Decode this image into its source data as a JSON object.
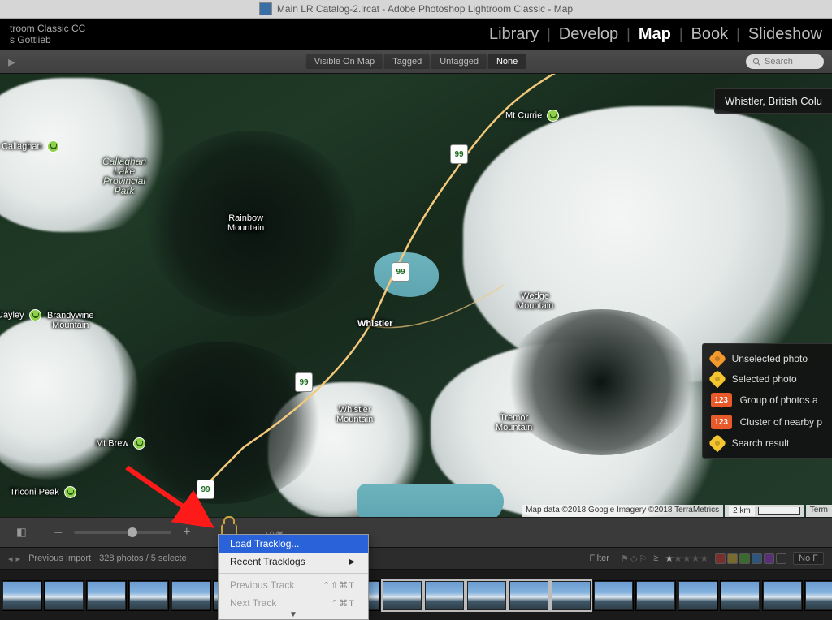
{
  "window": {
    "title": "Main LR Catalog-2.lrcat - Adobe Photoshop Lightroom Classic - Map"
  },
  "identity": {
    "line1": "troom Classic CC",
    "line2": "s Gottlieb"
  },
  "modules": {
    "library": "Library",
    "develop": "Develop",
    "map": "Map",
    "book": "Book",
    "slideshow": "Slideshow",
    "active": "map"
  },
  "location_filters": {
    "visible": "Visible On Map",
    "tagged": "Tagged",
    "untagged": "Untagged",
    "none": "None"
  },
  "search": {
    "placeholder": "Search"
  },
  "map": {
    "location_chip": "Whistler, British Colu",
    "labels": {
      "mt_currie": "Mt Currie",
      "callaghan": "Callaghan\nLake\nProvincial\nPark",
      "mt_callaghan": "t Callaghan",
      "rainbow": "Rainbow\nMountain",
      "cayley": "Cayley",
      "brandywine": "Brandywine\nMountain",
      "whistler_town": "Whistler",
      "whistler_mtn": "Whistler\nMountain",
      "wedge": "Wedge\nMountain",
      "tremor": "Tremor\nMountain",
      "mt_brew": "Mt Brew",
      "triconi": "Triconi Peak"
    },
    "highway": "99",
    "attribution": "Map data ©2018 Google Imagery ©2018 TerraMetrics",
    "scale_label": "2 km",
    "terms": "Term"
  },
  "legend": {
    "unselected": "Unselected photo",
    "selected": "Selected photo",
    "group": "Group of photos a",
    "cluster": "Cluster of nearby p",
    "search": "Search result",
    "badge": "123"
  },
  "filmstrip_bar": {
    "source": "Previous Import",
    "counts": "328 photos / 5 selecte",
    "filter_label": "Filter :",
    "no_filter": "No F"
  },
  "context_menu": {
    "load": "Load Tracklog...",
    "recent": "Recent Tracklogs",
    "prev": "Previous Track",
    "prev_key": "⌃⇧⌘T",
    "next": "Next Track",
    "next_key": "⌃⌘T"
  }
}
